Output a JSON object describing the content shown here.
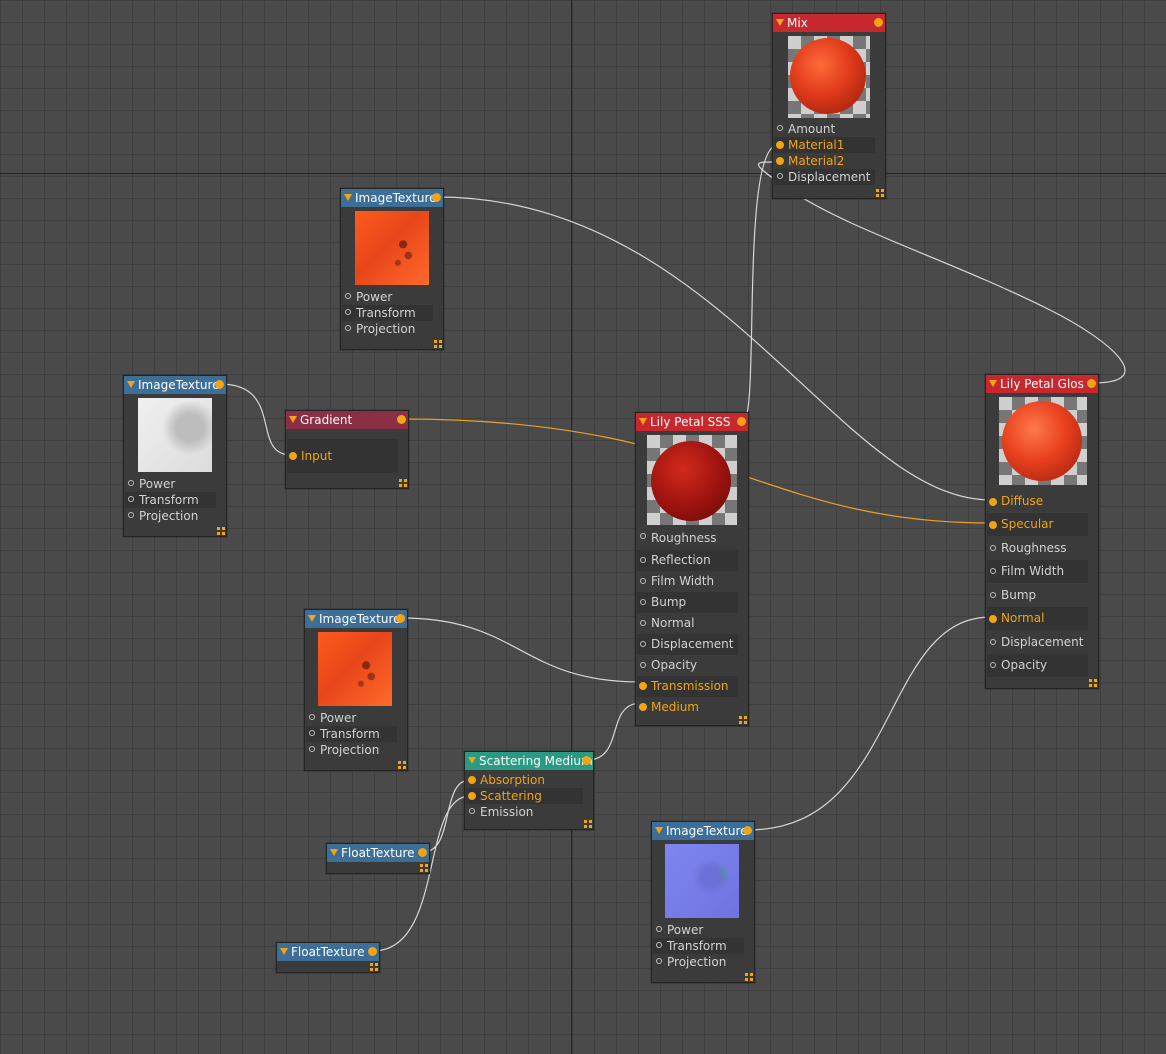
{
  "colors": {
    "canvas_bg": "#4a4a4a",
    "grid": "#3f3f3f",
    "node_body": "#3b3b3b",
    "image_texture_header": "#3c6e98",
    "material_header": "#c7282e",
    "gradient_header": "#8c2f44",
    "medium_header": "#2a9b83",
    "connected_port": "#f1a414",
    "wire_default": "#d6d6d6",
    "wire_selected": "#e9a125"
  },
  "nodes": {
    "mix": {
      "title": "Mix",
      "inputs": [
        "Amount",
        "Material1",
        "Material2",
        "Displacement"
      ]
    },
    "image_texture_top": {
      "title": "ImageTexture",
      "inputs": [
        "Power",
        "Transform",
        "Projection"
      ]
    },
    "image_texture_left": {
      "title": "ImageTexture",
      "inputs": [
        "Power",
        "Transform",
        "Projection"
      ]
    },
    "gradient": {
      "title": "Gradient",
      "inputs": [
        "Input"
      ]
    },
    "lily_sss": {
      "title": "Lily Petal SSS",
      "inputs": [
        "Roughness",
        "Reflection",
        "Film Width",
        "Bump",
        "Normal",
        "Displacement",
        "Opacity",
        "Transmission",
        "Medium"
      ]
    },
    "lily_glos": {
      "title": "Lily Petal Glos",
      "inputs": [
        "Diffuse",
        "Specular",
        "Roughness",
        "Film Width",
        "Bump",
        "Normal",
        "Displacement",
        "Opacity"
      ]
    },
    "image_texture_mid": {
      "title": "ImageTexture",
      "inputs": [
        "Power",
        "Transform",
        "Projection"
      ]
    },
    "scattering_medium": {
      "title": "Scattering Medium",
      "inputs": [
        "Absorption",
        "Scattering",
        "Emission"
      ]
    },
    "float_texture_1": {
      "title": "FloatTexture"
    },
    "float_texture_2": {
      "title": "FloatTexture"
    },
    "image_texture_normal": {
      "title": "ImageTexture",
      "inputs": [
        "Power",
        "Transform",
        "Projection"
      ]
    }
  }
}
